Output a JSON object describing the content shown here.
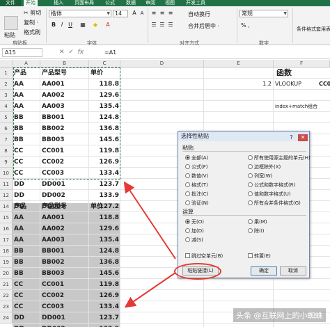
{
  "tabs": [
    "文件",
    "开始",
    "插入",
    "页面布局",
    "公式",
    "数据",
    "审阅",
    "视图",
    "开发工具"
  ],
  "ribbon": {
    "paste": "粘贴",
    "cut": "✂ 剪切",
    "copy": "复制 ·",
    "format_painter": "格式刷",
    "font_name": "楷体",
    "font_size": "14",
    "wrap_text": "自动换行",
    "merge_center": "合并后居中 ·",
    "number_format": "常规",
    "cond_format": "条件格式",
    "format_as_table": "套用表格格式",
    "group_clipboard": "剪贴板",
    "group_font": "字体",
    "group_alignment": "对齐方式",
    "group_number": "数字",
    "percent": "% ,"
  },
  "formula_bar": {
    "name_box": "A15",
    "formula": "=A1"
  },
  "columns": [
    "A",
    "B",
    "C",
    "D",
    "E",
    "F"
  ],
  "rows": [
    "1",
    "2",
    "3",
    "4",
    "5",
    "6",
    "7",
    "8",
    "9",
    "10",
    "11",
    "12",
    "13",
    "14",
    "15",
    "16",
    "17",
    "18",
    "19",
    "20",
    "21",
    "22",
    "23",
    "24",
    "25"
  ],
  "table_top": {
    "headers": [
      "产品",
      "产品型号",
      "单价"
    ],
    "rows": [
      [
        "AA",
        "AA001",
        "118.8"
      ],
      [
        "AA",
        "AA002",
        "129.6"
      ],
      [
        "AA",
        "AA003",
        "135.4"
      ],
      [
        "BB",
        "BB001",
        "124.8"
      ],
      [
        "BB",
        "BB002",
        "136.8"
      ],
      [
        "BB",
        "BB003",
        "145.6"
      ],
      [
        "CC",
        "CC001",
        "119.8"
      ],
      [
        "CC",
        "CC002",
        "126.9"
      ],
      [
        "CC",
        "CC003",
        "133.4"
      ],
      [
        "DD",
        "DD001",
        "123.7"
      ],
      [
        "DD",
        "DD002",
        "133.9"
      ],
      [
        "DD",
        "DD003",
        "127.2"
      ]
    ]
  },
  "table_bottom": {
    "headers": [
      "产品",
      "产品型号",
      "单价"
    ],
    "rows": [
      [
        "AA",
        "AA001",
        "118.8"
      ],
      [
        "AA",
        "AA002",
        "129.6"
      ],
      [
        "AA",
        "AA003",
        "135.4"
      ],
      [
        "BB",
        "BB001",
        "124.8"
      ],
      [
        "BB",
        "BB002",
        "136.8"
      ],
      [
        "BB",
        "BB003",
        "145.6"
      ],
      [
        "CC",
        "CC001",
        "119.8"
      ],
      [
        "CC",
        "CC002",
        "126.9"
      ],
      [
        "CC",
        "CC003",
        "133.4"
      ],
      [
        "DD",
        "DD001",
        "123.7"
      ],
      [
        "DD",
        "DD002",
        "133.9"
      ]
    ]
  },
  "right_side": {
    "func_header": "函数",
    "e2": "1.2",
    "f2": "VLOOKUP",
    "f2_next": "CC0",
    "f4": "index+match组合",
    "f4_next": "CC0"
  },
  "dialog": {
    "title": "选择性粘贴",
    "help": "?",
    "close": "✕",
    "paste_section": "粘贴",
    "paste_options_left": [
      "全部(A)",
      "公式(F)",
      "数值(V)",
      "格式(T)",
      "批注(C)",
      "验证(N)"
    ],
    "paste_options_right": [
      "所有使用源主题的单元(H)",
      "边框除外(X)",
      "列宽(W)",
      "公式和数字格式(R)",
      "值和数字格式(U)",
      "所有合并条件格式(G)"
    ],
    "operation_section": "运算",
    "operation_left": [
      "无(O)",
      "加(D)",
      "减(S)"
    ],
    "operation_right": [
      "乘(M)",
      "除(I)"
    ],
    "skip_blanks": "跳过空单元(B)",
    "transpose": "转置(E)",
    "paste_link": "粘贴链接(L)",
    "ok": "确定",
    "cancel": "取消"
  },
  "watermark": "头条 @互联网上的小蜘蛛"
}
